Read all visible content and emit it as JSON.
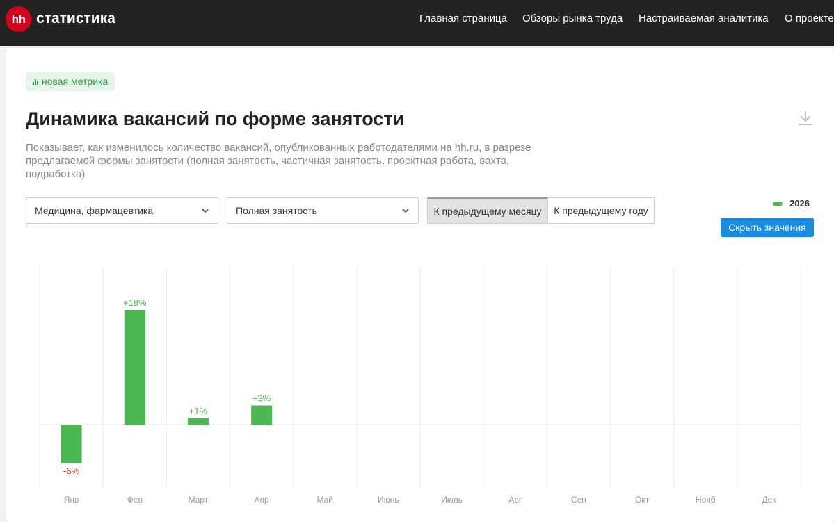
{
  "header": {
    "logo_text": "hh",
    "brand": "статистика",
    "nav": [
      {
        "label": "Главная страница"
      },
      {
        "label": "Обзоры рынка труда"
      },
      {
        "label": "Настраиваемая аналитика"
      },
      {
        "label": "О проекте"
      }
    ]
  },
  "badge": {
    "label": "новая метрика",
    "icon": "bar-chart-icon"
  },
  "title": "Динамика вакансий по форме занятости",
  "description": "Показывает, как изменилось количество вакансий, опубликованных работодателями на hh.ru, в разрезе предлагаемой формы занятости (полная занятость, частичная занятость, проектная работа, вахта, подработка)",
  "filters": {
    "industry": {
      "value": "Медицина, фармацевтика"
    },
    "employment": {
      "value": "Полная занятость"
    }
  },
  "compare": {
    "options": [
      "К предыдущему месяцу",
      "К предыдущему году"
    ],
    "selected": "К предыдущему месяцу"
  },
  "legend_label": "2026",
  "toggle_values_label": "Скрыть значения",
  "colors": {
    "header": "#232323",
    "brand_red": "#d6001c",
    "bar": "#4cb852",
    "positive_label": "#4cb852",
    "negative_label": "#c0392b",
    "button": "#1a8ce0"
  },
  "chart_data": {
    "type": "bar",
    "categories": [
      "Янв",
      "Фев",
      "Март",
      "Апр",
      "Май",
      "Июнь",
      "Июль",
      "Авг",
      "Сен",
      "Окт",
      "Нояб",
      "Дек"
    ],
    "series": [
      {
        "name": "2026",
        "values": [
          -6,
          18,
          1,
          3,
          null,
          null,
          null,
          null,
          null,
          null,
          null,
          null
        ]
      }
    ],
    "value_labels": [
      "-6%",
      "+18%",
      "+1%",
      "+3%",
      "",
      "",
      "",
      "",
      "",
      "",
      "",
      ""
    ],
    "unit": "%",
    "grid": true
  }
}
